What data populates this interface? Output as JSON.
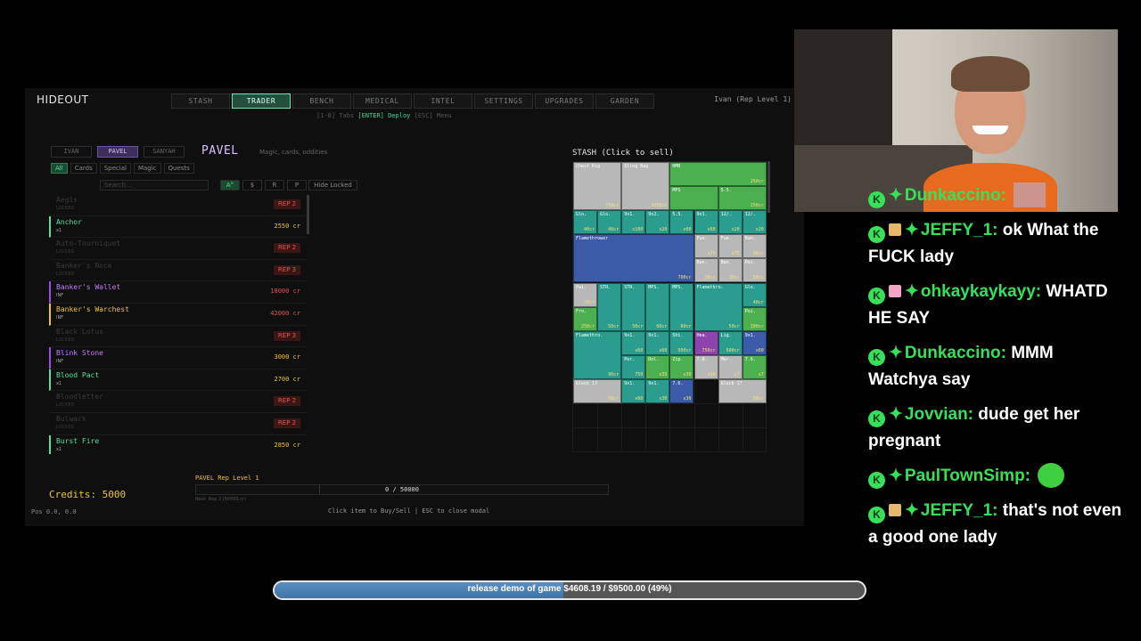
{
  "game": {
    "title": "HIDEOUT",
    "tabs": [
      "STASH",
      "TRADER",
      "BENCH",
      "MEDICAL",
      "INTEL",
      "SETTINGS",
      "UPGRADES",
      "GARDEN"
    ],
    "active_tab": "TRADER",
    "hint_prefix": "[1-8] Tabs",
    "hint_key": "[ENTER] Deploy",
    "hint_suffix": "[ESC] Menu",
    "user": "Ivan (Rep Level 1)",
    "traders": [
      "IVAN",
      "PAVEL",
      "SANYAH"
    ],
    "active_trader": "PAVEL",
    "trader_name": "PAVEL",
    "trader_desc": "Magic, cards, oddities",
    "filters": [
      "All",
      "Cards",
      "Special",
      "Magic",
      "Quests"
    ],
    "active_filter": "All",
    "search_placeholder": "Search...",
    "sorts": [
      "A°",
      "$",
      "R",
      "P"
    ],
    "hide_locked": "Hide Locked",
    "items": [
      {
        "name": "Aegis",
        "sub": "LOCKED",
        "locked": true,
        "rep": "REP 2"
      },
      {
        "name": "Anchor",
        "sub": "x1",
        "color": "#56e09a",
        "bar": "#56e09a",
        "price": "2550 cr",
        "price_color": "#f0c23c"
      },
      {
        "name": "Auto-Tourniquet",
        "sub": "LOCKED",
        "locked": true,
        "rep": "REP 2"
      },
      {
        "name": "Banker's Noce",
        "sub": "LOCKED",
        "locked": true,
        "rep": "REP 3"
      },
      {
        "name": "Banker's Wallet",
        "sub": "INF",
        "color": "#c57bff",
        "bar": "#9b4de0",
        "price": "18000 cr",
        "price_color": "#e05555"
      },
      {
        "name": "Banker's Warchest",
        "sub": "INF",
        "color": "#f0c23c",
        "bar": "#f0c23c",
        "price": "42000 cr",
        "price_color": "#e05555"
      },
      {
        "name": "Black Lotus",
        "sub": "LOCKED",
        "locked": true,
        "rep": "REP 3"
      },
      {
        "name": "Blink Stone",
        "sub": "INF",
        "color": "#c57bff",
        "bar": "#9b4de0",
        "price": "3000 cr",
        "price_color": "#f0c23c"
      },
      {
        "name": "Blood Pact",
        "sub": "x1",
        "color": "#56e09a",
        "bar": "#56e09a",
        "price": "2700 cr",
        "price_color": "#f0c23c"
      },
      {
        "name": "Bloodletter",
        "sub": "LOCKED",
        "locked": true,
        "rep": "REP 2"
      },
      {
        "name": "Bulwark",
        "sub": "LOCKED",
        "locked": true,
        "rep": "REP 2"
      },
      {
        "name": "Burst Fire",
        "sub": "x1",
        "color": "#56e09a",
        "bar": "#56e09a",
        "price": "2850 cr",
        "price_color": "#f0c23c"
      }
    ],
    "stash_title": "STASH (Click to sell)",
    "stash_cells": [
      {
        "c": 0,
        "r": 0,
        "w": 2,
        "h": 2,
        "bg": "#b8b8b8",
        "t": "Chest Rig",
        "p": "750cr"
      },
      {
        "c": 2,
        "r": 0,
        "w": 2,
        "h": 2,
        "bg": "#b8b8b8",
        "t": "Sling Bag",
        "p": "1000cr"
      },
      {
        "c": 4,
        "r": 0,
        "w": 4,
        "h": 1,
        "bg": "#4caf50",
        "t": "HMR",
        "p": "250cr"
      },
      {
        "c": 4,
        "r": 1,
        "w": 2,
        "h": 1,
        "bg": "#4caf50",
        "t": "MPS",
        "p": ""
      },
      {
        "c": 6,
        "r": 1,
        "w": 2,
        "h": 1,
        "bg": "#4caf50",
        "t": "5.5.",
        "p": "150cr"
      },
      {
        "c": 0,
        "r": 2,
        "w": 1,
        "h": 1,
        "bg": "#2a9d8f",
        "t": "Glo.",
        "p": "40cr"
      },
      {
        "c": 1,
        "r": 2,
        "w": 1,
        "h": 1,
        "bg": "#2a9d8f",
        "t": "Glo.",
        "p": "40cr"
      },
      {
        "c": 2,
        "r": 2,
        "w": 1,
        "h": 1,
        "bg": "#2a9d8f",
        "t": "9x1.",
        "p": "x100"
      },
      {
        "c": 3,
        "r": 2,
        "w": 1,
        "h": 1,
        "bg": "#2a9d8f",
        "t": "9x2.",
        "p": "x20"
      },
      {
        "c": 4,
        "r": 2,
        "w": 1,
        "h": 1,
        "bg": "#2a9d8f",
        "t": "5.5.",
        "p": "x60"
      },
      {
        "c": 5,
        "r": 2,
        "w": 1,
        "h": 1,
        "bg": "#2a9d8f",
        "t": "9x1.",
        "p": "x60"
      },
      {
        "c": 6,
        "r": 2,
        "w": 1,
        "h": 1,
        "bg": "#2a9d8f",
        "t": "12/.",
        "p": "x20"
      },
      {
        "c": 7,
        "r": 2,
        "w": 1,
        "h": 1,
        "bg": "#2a9d8f",
        "t": "12/.",
        "p": "x20"
      },
      {
        "c": 0,
        "r": 3,
        "w": 5,
        "h": 2,
        "bg": "#3b5ba9",
        "t": "Flamethrower",
        "p": "700cr"
      },
      {
        "c": 5,
        "r": 3,
        "w": 1,
        "h": 1,
        "bg": "#b8b8b8",
        "t": "Fue.",
        "p": "x75"
      },
      {
        "c": 6,
        "r": 3,
        "w": 1,
        "h": 1,
        "bg": "#b8b8b8",
        "t": "Fue.",
        "p": "x75"
      },
      {
        "c": 7,
        "r": 3,
        "w": 1,
        "h": 1,
        "bg": "#b8b8b8",
        "t": "Ban.",
        "p": "30cr"
      },
      {
        "c": 5,
        "r": 4,
        "w": 1,
        "h": 1,
        "bg": "#b8b8b8",
        "t": "Ban.",
        "p": "30cr"
      },
      {
        "c": 6,
        "r": 4,
        "w": 1,
        "h": 1,
        "bg": "#b8b8b8",
        "t": "Ban.",
        "p": "30cr"
      },
      {
        "c": 7,
        "r": 4,
        "w": 1,
        "h": 1,
        "bg": "#b8b8b8",
        "t": "Pai.",
        "p": "50cr"
      },
      {
        "c": 0,
        "r": 5,
        "w": 1,
        "h": 1,
        "bg": "#b8b8b8",
        "t": "Pai.",
        "p": "20cr"
      },
      {
        "c": 1,
        "r": 5,
        "w": 1,
        "h": 2,
        "bg": "#2a9d8f",
        "t": "STR.",
        "p": "50cr"
      },
      {
        "c": 2,
        "r": 5,
        "w": 1,
        "h": 2,
        "bg": "#2a9d8f",
        "t": "STR.",
        "p": "50cr"
      },
      {
        "c": 3,
        "r": 5,
        "w": 1,
        "h": 2,
        "bg": "#2a9d8f",
        "t": "MPS.",
        "p": "60cr"
      },
      {
        "c": 4,
        "r": 5,
        "w": 1,
        "h": 2,
        "bg": "#2a9d8f",
        "t": "MPS.",
        "p": "60cr"
      },
      {
        "c": 5,
        "r": 5,
        "w": 2,
        "h": 2,
        "bg": "#2a9d8f",
        "t": "Flamethro.",
        "p": "50cr"
      },
      {
        "c": 7,
        "r": 5,
        "w": 1,
        "h": 1,
        "bg": "#2a9d8f",
        "t": "Glo.",
        "p": "40cr"
      },
      {
        "c": 0,
        "r": 6,
        "w": 1,
        "h": 1,
        "bg": "#4caf50",
        "t": "Fro.",
        "p": "250cr"
      },
      {
        "c": 7,
        "r": 6,
        "w": 1,
        "h": 1,
        "bg": "#4caf50",
        "t": "Poi.",
        "p": "300cr"
      },
      {
        "c": 0,
        "r": 7,
        "w": 2,
        "h": 2,
        "bg": "#2a9d8f",
        "t": "Flamethro.",
        "p": "90cr"
      },
      {
        "c": 2,
        "r": 7,
        "w": 1,
        "h": 1,
        "bg": "#2a9d8f",
        "t": "9x1.",
        "p": "x60"
      },
      {
        "c": 3,
        "r": 7,
        "w": 1,
        "h": 1,
        "bg": "#2a9d8f",
        "t": "9x1.",
        "p": "x60"
      },
      {
        "c": 4,
        "r": 7,
        "w": 1,
        "h": 1,
        "bg": "#2a9d8f",
        "t": "Shi.",
        "p": "500cr"
      },
      {
        "c": 5,
        "r": 7,
        "w": 1,
        "h": 1,
        "bg": "#8e44ad",
        "t": "Hea.",
        "p": "750cr"
      },
      {
        "c": 6,
        "r": 7,
        "w": 1,
        "h": 1,
        "bg": "#2a9d8f",
        "t": "Lig.",
        "p": "600cr"
      },
      {
        "c": 7,
        "r": 7,
        "w": 1,
        "h": 1,
        "bg": "#3b5ba9",
        "t": "9x1.",
        "p": "x60"
      },
      {
        "c": 2,
        "r": 8,
        "w": 1,
        "h": 1,
        "bg": "#2a9d8f",
        "t": "Per.",
        "p": "750"
      },
      {
        "c": 3,
        "r": 8,
        "w": 1,
        "h": 1,
        "bg": "#4caf50",
        "t": "Dol.",
        "p": "x35"
      },
      {
        "c": 4,
        "r": 8,
        "w": 1,
        "h": 1,
        "bg": "#4caf50",
        "t": "Zip.",
        "p": "x30"
      },
      {
        "c": 5,
        "r": 8,
        "w": 1,
        "h": 1,
        "bg": "#b8b8b8",
        "t": "7.6.",
        "p": "x30"
      },
      {
        "c": 6,
        "r": 8,
        "w": 1,
        "h": 1,
        "bg": "#b8b8b8",
        "t": "Mer.",
        "p": "x7"
      },
      {
        "c": 7,
        "r": 8,
        "w": 1,
        "h": 1,
        "bg": "#4caf50",
        "t": "7.6.",
        "p": "x7"
      },
      {
        "c": 0,
        "r": 9,
        "w": 2,
        "h": 1,
        "bg": "#b8b8b8",
        "t": "Glock 17",
        "p": "50cr"
      },
      {
        "c": 2,
        "r": 9,
        "w": 1,
        "h": 1,
        "bg": "#2a9d8f",
        "t": "9x1.",
        "p": "x60"
      },
      {
        "c": 3,
        "r": 9,
        "w": 1,
        "h": 1,
        "bg": "#2a9d8f",
        "t": "9x1.",
        "p": "x30"
      },
      {
        "c": 4,
        "r": 9,
        "w": 1,
        "h": 1,
        "bg": "#3b5ba9",
        "t": "7.6.",
        "p": "x36"
      },
      {
        "c": 6,
        "r": 9,
        "w": 2,
        "h": 1,
        "bg": "#b8b8b8",
        "t": "Glock 17",
        "p": "50cr"
      }
    ],
    "credits": "Credits: 5000",
    "pos": "Pos 0.0, 0.0",
    "rep_label": "PAVEL Rep Level 1",
    "rep_progress_text": "0 / 50000",
    "rep_progress": 0,
    "rep_next": "Next: Rep 2 (50000 cr)",
    "footer_hint": "Click item to Buy/Sell  |  ESC to close modal"
  },
  "chat": [
    {
      "user": "Dunkaccino:",
      "gift": false,
      "text": "",
      "emote": "face"
    },
    {
      "user": "JEFFY_1:",
      "gift": "gold",
      "text": "ok What the FUCK lady"
    },
    {
      "user": "ohkaykaykayy:",
      "gift": "pink",
      "text": "WHATD HE SAY"
    },
    {
      "user": "Dunkaccino:",
      "gift": false,
      "text": "MMM Watchya say"
    },
    {
      "user": "Jovvian:",
      "gift": false,
      "text": "dude get her pregnant"
    },
    {
      "user": "PaulTownSimp:",
      "gift": false,
      "text": "",
      "emote": "green"
    },
    {
      "user": "JEFFY_1:",
      "gift": "gold",
      "text": "that's not even a good one lady"
    }
  ],
  "goal": {
    "text": "release demo of game $4608.19 / $9500.00 (49%)",
    "progress": 0.49
  },
  "colors": {
    "accent": "#38e05a",
    "credits": "#f0c23c",
    "locked_rep": "#e05555"
  }
}
